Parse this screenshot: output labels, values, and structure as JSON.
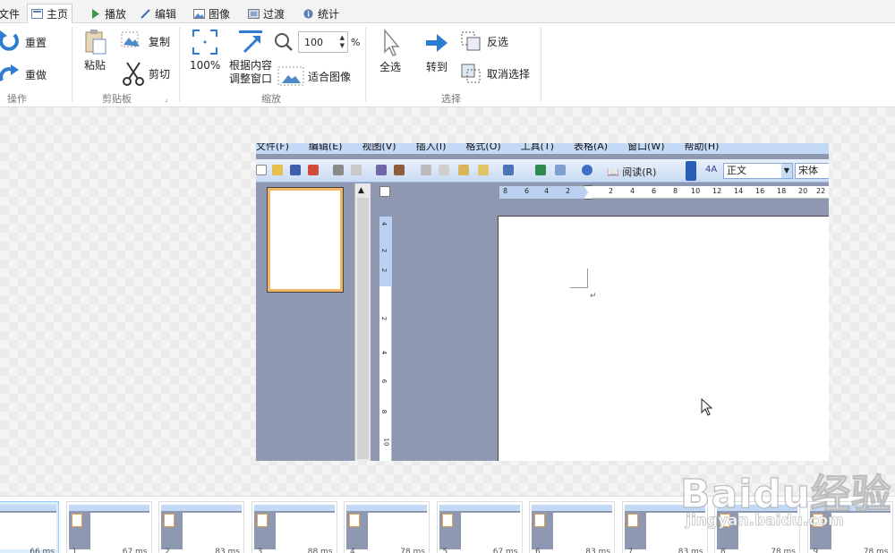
{
  "tabs": [
    {
      "label": "文件"
    },
    {
      "label": "主页"
    },
    {
      "label": "播放"
    },
    {
      "label": "编辑"
    },
    {
      "label": "图像"
    },
    {
      "label": "过渡"
    },
    {
      "label": "统计"
    }
  ],
  "ribbon": {
    "ops": {
      "redo_label": "重置",
      "repeat_label": "重做",
      "group": "操作"
    },
    "clipboard": {
      "paste": "粘贴",
      "copy": "复制",
      "cut": "剪切",
      "group": "剪贴板"
    },
    "zoom": {
      "fit100": "100%",
      "fit_content": "根据内容\n调整窗口",
      "zoom_value": "100",
      "percent": "%",
      "fit_image": "适合图像",
      "group": "缩放"
    },
    "select": {
      "select_all": "全选",
      "goto": "转到",
      "invert": "反选",
      "deselect": "取消选择",
      "group": "选择"
    }
  },
  "word": {
    "menu": [
      "文件(F)",
      "编辑(E)",
      "视图(V)",
      "插入(I)",
      "格式(O)",
      "工具(T)",
      "表格(A)",
      "窗口(W)",
      "帮助(H)"
    ],
    "read_label": "阅读(R)",
    "style_value": "正文",
    "font_value": "宋体",
    "hruler_nums": [
      "8",
      "6",
      "4",
      "2",
      "2",
      "4",
      "6",
      "8",
      "10",
      "12",
      "14",
      "16",
      "18",
      "20",
      "22"
    ],
    "vruler_nums": [
      "4",
      "2",
      "2",
      "2",
      "4",
      "6",
      "8",
      "10"
    ],
    "para_mark": "↵"
  },
  "filmstrip": [
    {
      "index": "",
      "dur": "66 ms"
    },
    {
      "index": "1",
      "dur": "67 ms"
    },
    {
      "index": "2",
      "dur": "83 ms"
    },
    {
      "index": "3",
      "dur": "88 ms"
    },
    {
      "index": "4",
      "dur": "78 ms"
    },
    {
      "index": "5",
      "dur": "67 ms"
    },
    {
      "index": "6",
      "dur": "83 ms"
    },
    {
      "index": "7",
      "dur": "83 ms"
    },
    {
      "index": "8",
      "dur": "78 ms"
    },
    {
      "index": "9",
      "dur": "78 ms"
    }
  ],
  "watermark": {
    "main": "Baidu经验",
    "sub": "jingyan.baidu.com"
  },
  "colors": {
    "accent": "#2e7cd1",
    "selected_frame": "#dbeefb",
    "word_bg": "#8e99b1"
  }
}
